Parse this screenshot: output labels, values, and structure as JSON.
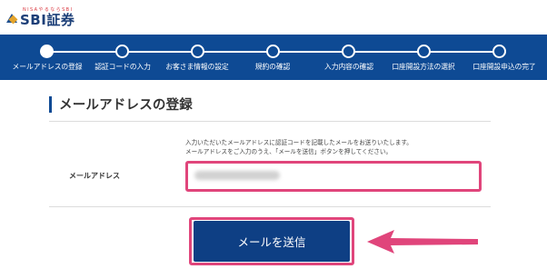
{
  "header": {
    "logo_ruby": "NISAやるならSBI",
    "logo_text": "SBI証券"
  },
  "progress": {
    "steps": [
      {
        "label": "メールアドレスの登録",
        "active": true
      },
      {
        "label": "認証コードの入力",
        "active": false
      },
      {
        "label": "お客さま情報の設定",
        "active": false
      },
      {
        "label": "規約の確認",
        "active": false
      },
      {
        "label": "入力内容の確認",
        "active": false
      },
      {
        "label": "口座開設方法の選択",
        "active": false
      },
      {
        "label": "口座開設申込の完了",
        "active": false
      }
    ]
  },
  "main": {
    "title": "メールアドレスの登録",
    "notice_line1": "入力いただいたメールアドレスに認証コードを記載したメールをお送りいたします。",
    "notice_line2": "メールアドレスをご入力のうえ、「メールを送信」ボタンを押してください。",
    "email_label": "メールアドレス",
    "send_button": "メールを送信"
  },
  "colors": {
    "brand_blue": "#0e4a94",
    "highlight_pink": "#e0457b"
  }
}
